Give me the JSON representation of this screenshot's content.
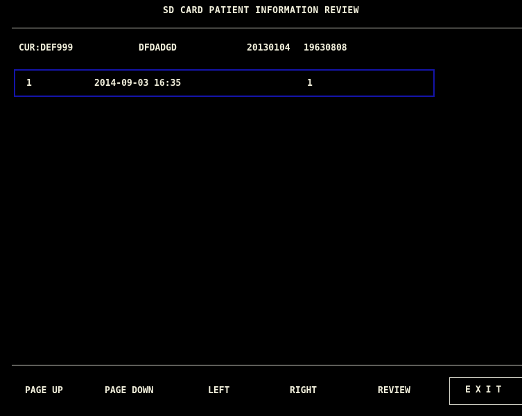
{
  "window": {
    "title": "SD CARD PATIENT INFORMATION REVIEW"
  },
  "current_patient": {
    "id_label": "CUR:DEF999",
    "name": "DFDADGD",
    "admit_date": "20130104",
    "birth_date": "19630808"
  },
  "records": [
    {
      "index": "1",
      "datetime": "2014-09-03 16:35",
      "count": "1"
    }
  ],
  "colors": {
    "background": "#000000",
    "text": "#f2f0dc",
    "selection_border": "#1414a8",
    "divider": "#cfcfc4"
  },
  "footer": {
    "page_up": "PAGE UP",
    "page_down": "PAGE DOWN",
    "left": "LEFT",
    "right": "RIGHT",
    "review": "REVIEW",
    "exit": "EXIT"
  }
}
